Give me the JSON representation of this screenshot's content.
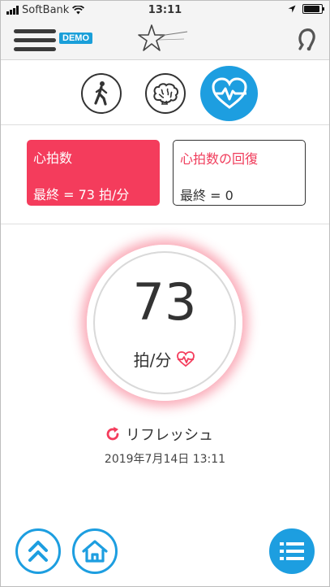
{
  "status_bar": {
    "carrier": "SoftBank",
    "time": "13:11"
  },
  "header": {
    "demo_badge": "DEMO",
    "icons": [
      "menu-icon",
      "star-logo-icon",
      "hearing-aid-icon"
    ]
  },
  "modes": [
    {
      "name": "walk",
      "icon": "walking-person-icon"
    },
    {
      "name": "brain",
      "icon": "brain-icon"
    },
    {
      "name": "heart",
      "icon": "heart-rate-icon",
      "active": true
    }
  ],
  "cards": {
    "heart_rate": {
      "title": "心拍数",
      "value": "最終 = 73 拍/分"
    },
    "recovery": {
      "title": "心拍数の回復",
      "value": "最終 = 0"
    }
  },
  "gauge": {
    "value": "73",
    "unit": "拍/分"
  },
  "refresh": {
    "label": "リフレッシュ",
    "timestamp": "2019年7月14日 13:11"
  },
  "footer": {
    "icons": [
      "double-chevron-up-icon",
      "home-icon",
      "list-icon"
    ]
  },
  "colors": {
    "accent_blue": "#1d9ee0",
    "accent_red": "#f43c5c",
    "header_bg": "#f4f4f4"
  }
}
